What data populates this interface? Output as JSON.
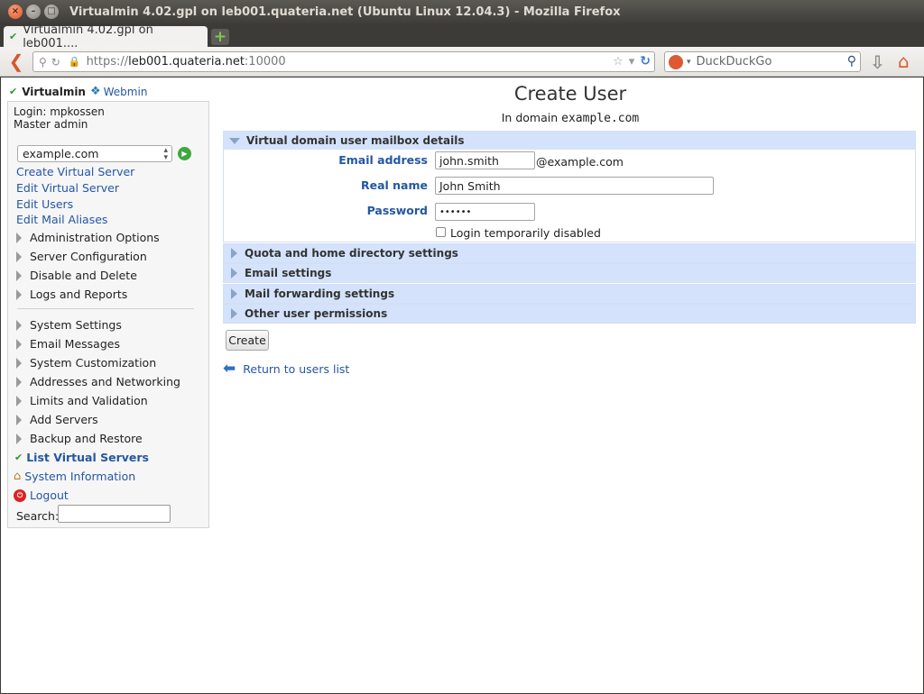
{
  "window": {
    "title": "Virtualmin 4.02.gpl on leb001.quateria.net (Ubuntu Linux 12.04.3) - Mozilla Firefox"
  },
  "browser": {
    "tab_label": "Virtualmin 4.02.gpl on leb001....",
    "url_scheme": "https://",
    "url_host": "leb001.quateria.net",
    "url_port": ":10000",
    "search_placeholder": "DuckDuckGo"
  },
  "sidebar": {
    "brand_virtualmin": "Virtualmin",
    "brand_webmin": "Webmin",
    "login_line": "Login: mpkossen",
    "role_line": "Master admin",
    "domain_selected": "example.com",
    "links": [
      "Create Virtual Server",
      "Edit Virtual Server",
      "Edit Users",
      "Edit Mail Aliases"
    ],
    "categories_a": [
      "Administration Options",
      "Server Configuration",
      "Disable and Delete",
      "Logs and Reports"
    ],
    "categories_b": [
      "System Settings",
      "Email Messages",
      "System Customization",
      "Addresses and Networking",
      "Limits and Validation",
      "Add Servers",
      "Backup and Restore"
    ],
    "list_virtual_servers": "List Virtual Servers",
    "system_information": "System Information",
    "logout": "Logout",
    "search_label": "Search:"
  },
  "main": {
    "title": "Create User",
    "subtitle_prefix": "In domain",
    "subtitle_domain": "example.com",
    "mailbox_section": "Virtual domain user mailbox details",
    "email_label": "Email address",
    "email_value": "john.smith",
    "email_suffix": "@example.com",
    "realname_label": "Real name",
    "realname_value": "John Smith",
    "password_label": "Password",
    "password_value": "••••••",
    "login_disabled_label": "Login temporarily disabled",
    "collapsed_sections": [
      "Quota and home directory settings",
      "Email settings",
      "Mail forwarding settings",
      "Other user permissions"
    ],
    "create_button": "Create",
    "return_link": "Return to users list"
  }
}
